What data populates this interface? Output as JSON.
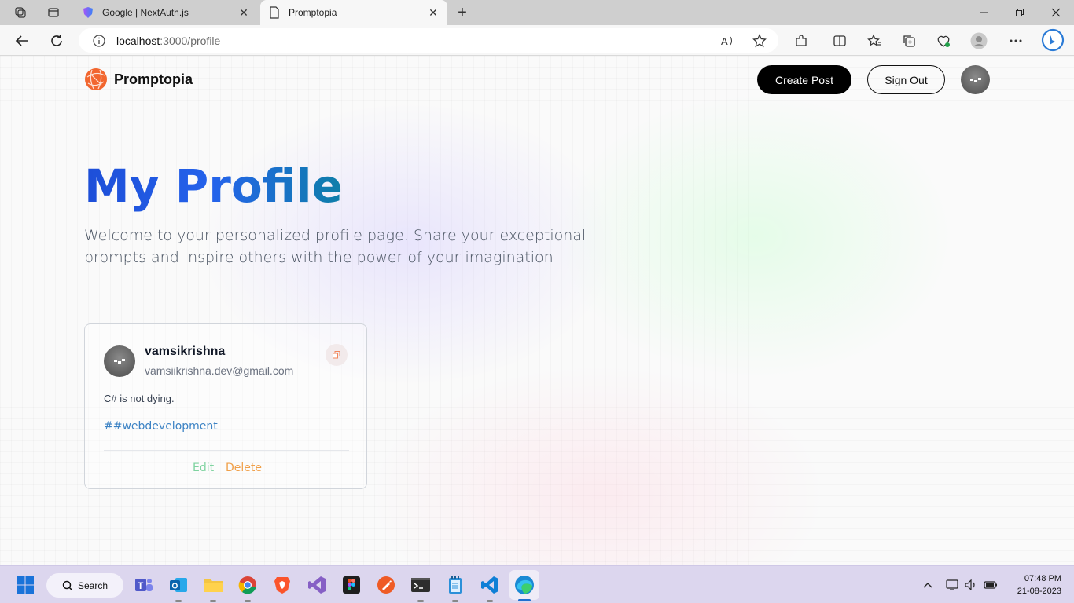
{
  "browser": {
    "tabs": [
      {
        "label": "Google | NextAuth.js",
        "active": false
      },
      {
        "label": "Promptopia",
        "active": true
      }
    ],
    "address": {
      "host": "localhost",
      "path": ":3000/profile"
    }
  },
  "header": {
    "brand": "Promptopia",
    "create_post_label": "Create Post",
    "sign_out_label": "Sign Out"
  },
  "profile": {
    "title": "My Profile",
    "description": "Welcome to your personalized profile page. Share your exceptional prompts and inspire others with the power of your imagination"
  },
  "posts": [
    {
      "username": "vamsikrishna",
      "email": "vamsiikrishna.dev@gmail.com",
      "prompt": "C# is not dying.",
      "tag": "##webdevelopment",
      "edit_label": "Edit",
      "delete_label": "Delete"
    }
  ],
  "taskbar": {
    "search_label": "Search",
    "time": "07:48 PM",
    "date": "21-08-2023",
    "apps": [
      "teams-icon",
      "outlook-icon",
      "file-explorer-icon",
      "chrome-icon",
      "brave-icon",
      "visual-studio-icon",
      "figma-icon",
      "postman-icon",
      "terminal-icon",
      "notepad-icon",
      "vscode-icon",
      "edge-icon"
    ]
  },
  "colors": {
    "title_gradient_start": "#1d4ed8",
    "title_gradient_end": "#0e7fa8",
    "edit": "#7fd3a0",
    "delete": "#f0a04a",
    "tag": "#3b82c4"
  }
}
